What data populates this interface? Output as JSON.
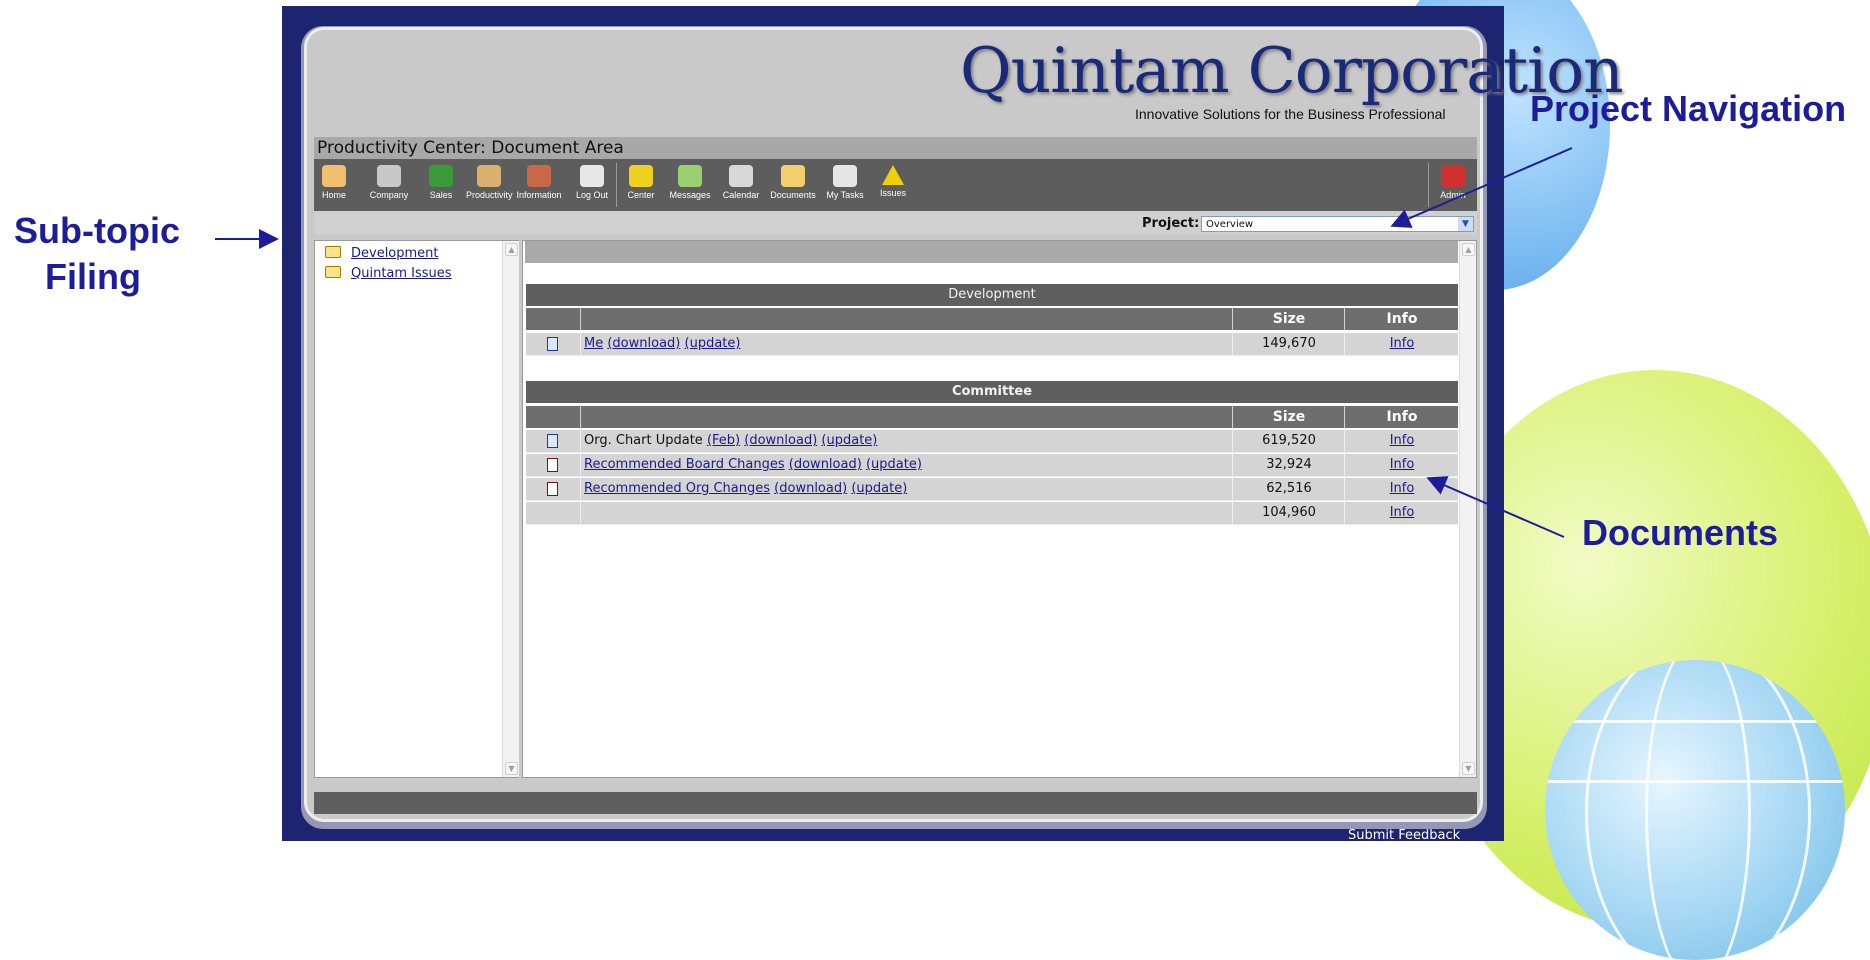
{
  "brand": {
    "name": "Quintam Corporation",
    "tagline": "Innovative Solutions for the Business Professional"
  },
  "area_title": "Productivity Center: Document Area",
  "toolbar": {
    "items": [
      {
        "label": "Home",
        "icon": "home-icon"
      },
      {
        "label": "Company",
        "icon": "company-icon"
      },
      {
        "label": "Sales",
        "icon": "sales-icon"
      },
      {
        "label": "Productivity",
        "icon": "productivity-icon"
      },
      {
        "label": "Information",
        "icon": "information-icon"
      },
      {
        "label": "Log Out",
        "icon": "logout-icon"
      },
      {
        "label": "Center",
        "icon": "center-icon"
      },
      {
        "label": "Messages",
        "icon": "messages-icon"
      },
      {
        "label": "Calendar",
        "icon": "calendar-icon"
      },
      {
        "label": "Documents",
        "icon": "documents-icon"
      },
      {
        "label": "My Tasks",
        "icon": "tasks-icon"
      },
      {
        "label": "Issues",
        "icon": "issues-icon"
      }
    ],
    "admin_label": "Admin"
  },
  "project": {
    "label": "Project:",
    "selected": "Overview"
  },
  "tree": {
    "items": [
      "Development",
      "Quintam Issues"
    ]
  },
  "sections": [
    {
      "title": "Development",
      "col_size": "Size",
      "col_info": "Info",
      "rows": [
        {
          "name": "Me",
          "extra": "",
          "download": "(download)",
          "update": "(update)",
          "size": "149,670",
          "info": "Info"
        }
      ]
    },
    {
      "title": "Committee",
      "col_size": "Size",
      "col_info": "Info",
      "rows": [
        {
          "name": "Org. Chart Update",
          "extra": "(Feb)",
          "download": "(download)",
          "update": "(update)",
          "size": "619,520",
          "info": "Info"
        },
        {
          "name": "Recommended Board Changes",
          "extra": "",
          "download": "(download)",
          "update": "(update)",
          "size": "32,924",
          "info": "Info"
        },
        {
          "name": "Recommended Org Changes",
          "extra": "",
          "download": "(download)",
          "update": "(update)",
          "size": "62,516",
          "info": "Info"
        },
        {
          "name": "",
          "extra": "",
          "download": "",
          "update": "",
          "size": "104,960",
          "info": "Info"
        }
      ]
    }
  ],
  "footer": {
    "feedback": "Submit Feedback"
  },
  "annotations": {
    "subtopic_line1": "Sub-topic",
    "subtopic_line2": "Filing",
    "project_nav": "Project Navigation",
    "documents": "Documents"
  }
}
